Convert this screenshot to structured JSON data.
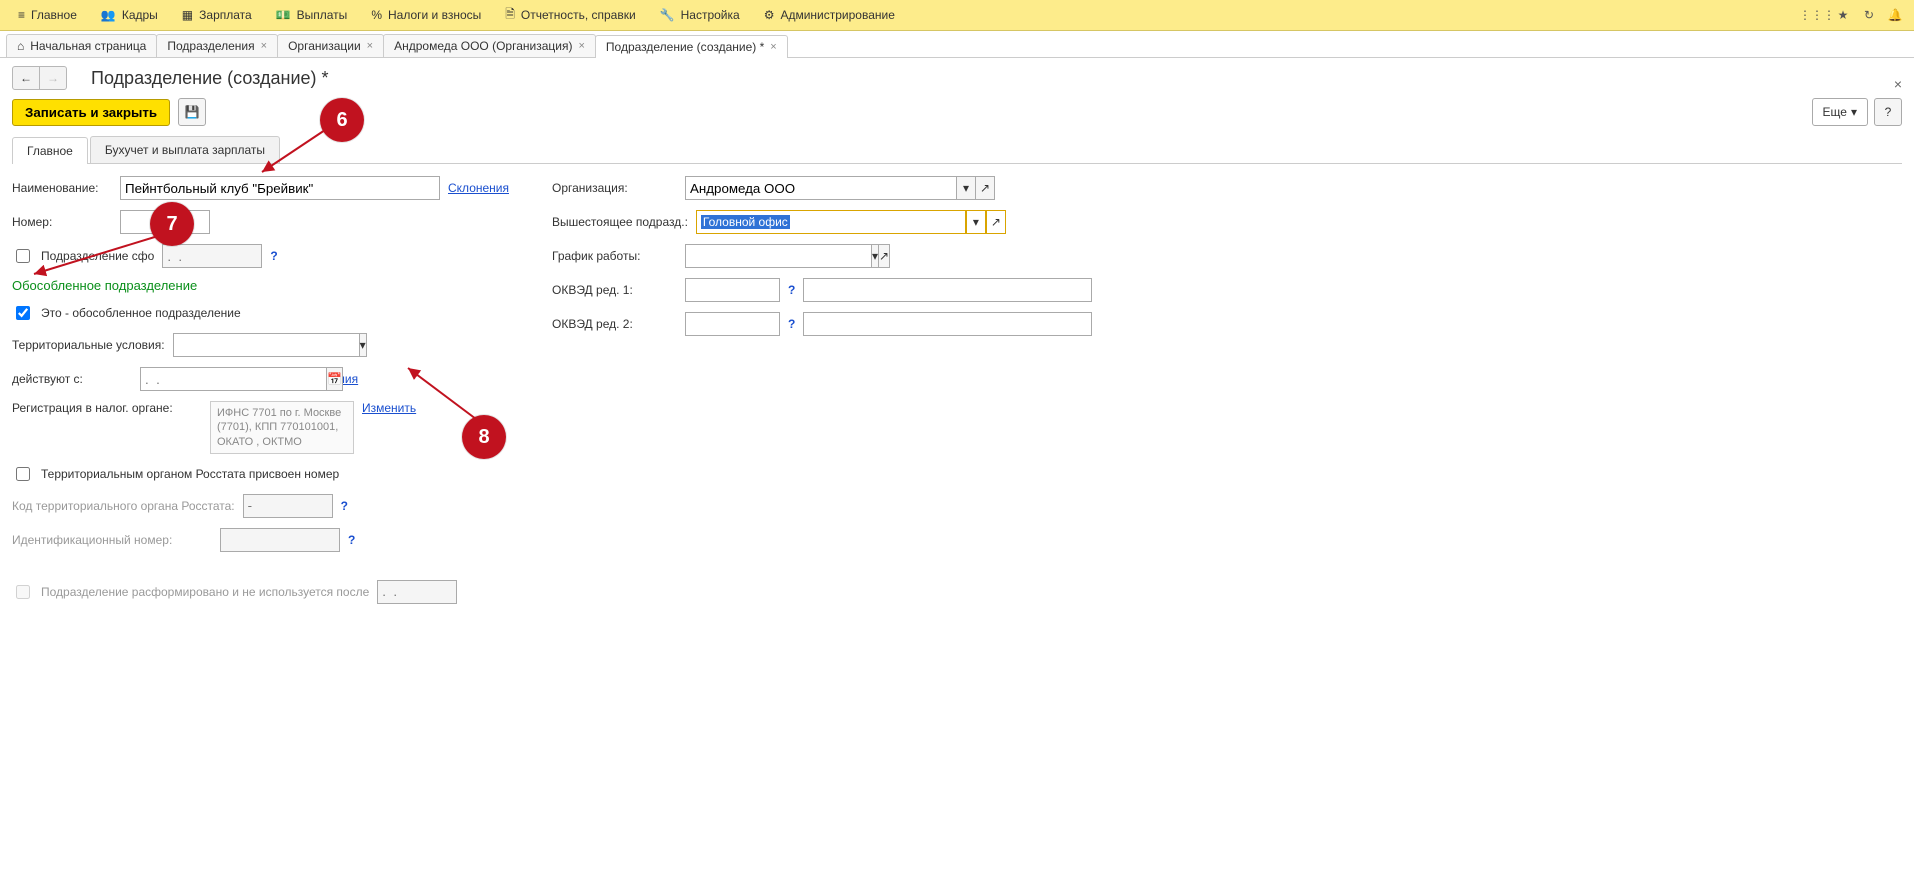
{
  "menu": {
    "main": "Главное",
    "hr": "Кадры",
    "salary": "Зарплата",
    "pay": "Выплаты",
    "tax": "Налоги и взносы",
    "report": "Отчетность, справки",
    "setup": "Настройка",
    "admin": "Администрирование"
  },
  "tabs": {
    "home": "Начальная страница",
    "dept": "Подразделения",
    "org": "Организации",
    "andro": "Андромеда ООО (Организация)",
    "current": "Подразделение (создание) *"
  },
  "pageTitle": "Подразделение (создание) *",
  "toolbar": {
    "save": "Записать и закрыть",
    "more": "Еще"
  },
  "formTabs": {
    "main": "Главное",
    "acc": "Бухучет и выплата зарплаты"
  },
  "left": {
    "name_lbl": "Наименование:",
    "name_val": "Пейнтбольный клуб \"Брейвик\"",
    "decl": "Склонения",
    "num_lbl": "Номер:",
    "formed_lbl": "Подразделение сфо",
    "formed_ph": ".  .",
    "sep_title": "Обособленное подразделение",
    "sep_chk": "Это - обособленное подразделение",
    "terr_lbl": "Территориальные условия:",
    "from_lbl": "действуют с:",
    "from_ph": ".  .",
    "history": "История изменения",
    "taxreg_lbl": "Регистрация в налог. органе:",
    "taxreg_val": "ИФНС 7701 по г. Москве (7701), КПП 770101001, ОКАТО , ОКТМО",
    "change": "Изменить",
    "rosstat_chk": "Территориальным органом Росстата присвоен номер",
    "rosstat_code_lbl": "Код территориального органа Росстата:",
    "rosstat_code_ph": "-",
    "ident_lbl": "Идентификационный номер:",
    "disband_lbl": "Подразделение расформировано и не используется после",
    "disband_ph": ".  ."
  },
  "right": {
    "org_lbl": "Организация:",
    "org_val": "Андромеда ООО",
    "parent_lbl": "Вышестоящее подразд.:",
    "parent_val": "Головной офис",
    "sched_lbl": "График работы:",
    "okved1_lbl": "ОКВЭД ред. 1:",
    "okved2_lbl": "ОКВЭД ред. 2:"
  },
  "callouts": {
    "c6": "6",
    "c7": "7",
    "c8": "8"
  },
  "help": "?"
}
